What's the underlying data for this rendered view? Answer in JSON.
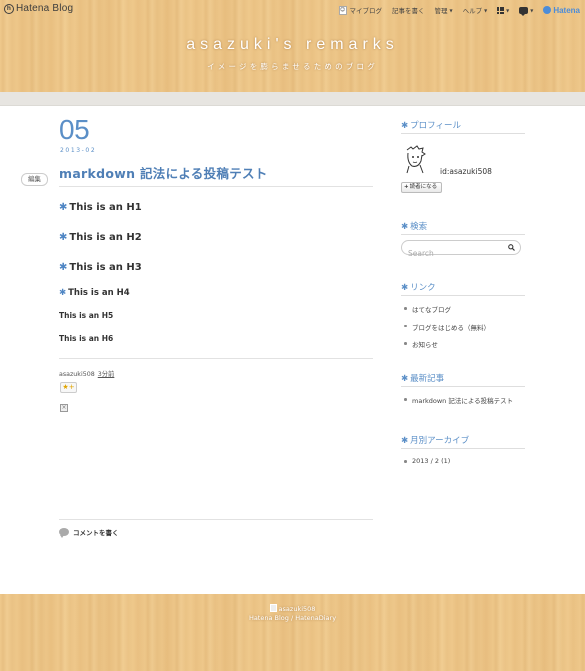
{
  "globalbar": {
    "logo_glyph": "h",
    "logo_text": "Hatena Blog",
    "my_blog": "マイブログ",
    "write": "記事を書く",
    "manage": "管理",
    "help": "ヘルプ",
    "brand": "Hatena",
    "icons": [
      "avatar-icon",
      "apps-grid-icon",
      "notification-icon",
      "hatena-logo-icon"
    ]
  },
  "header": {
    "title": "asazuki's remarks",
    "description": "イメージを膨らませるためのブログ"
  },
  "entry": {
    "day": "05",
    "year_month": "2013-02",
    "edit_label": "編集",
    "title": "markdown 記法による投稿テスト",
    "headings": {
      "h1": "This is an H1",
      "h2": "This is an H2",
      "h3": "This is an H3",
      "h4": "This is an H4",
      "h5": "This is an H5",
      "h6": "This is an H6"
    },
    "author": "asazuki508",
    "time": "3分前",
    "star_label": "★+",
    "comment_label": "コメントを書く"
  },
  "sidebar": {
    "profile": {
      "heading": "プロフィール",
      "id": "id:asazuki508",
      "reader_button": "読者になる"
    },
    "search": {
      "heading": "検索",
      "placeholder": "Search"
    },
    "links": {
      "heading": "リンク",
      "items": [
        "はてなブログ",
        "ブログをはじめる（無料）",
        "お知らせ"
      ]
    },
    "recent": {
      "heading": "最新記事",
      "items": [
        "markdown 記法による投稿テスト"
      ]
    },
    "archive": {
      "heading": "月別アーカイブ",
      "items": [
        "2013 / 2 (1)"
      ]
    }
  },
  "footer": {
    "user": "asazuki508",
    "links": "Hatena Blog / HatenaDiary"
  },
  "colors": {
    "accent": "#5b8fc7",
    "wood": "#efc98c"
  }
}
